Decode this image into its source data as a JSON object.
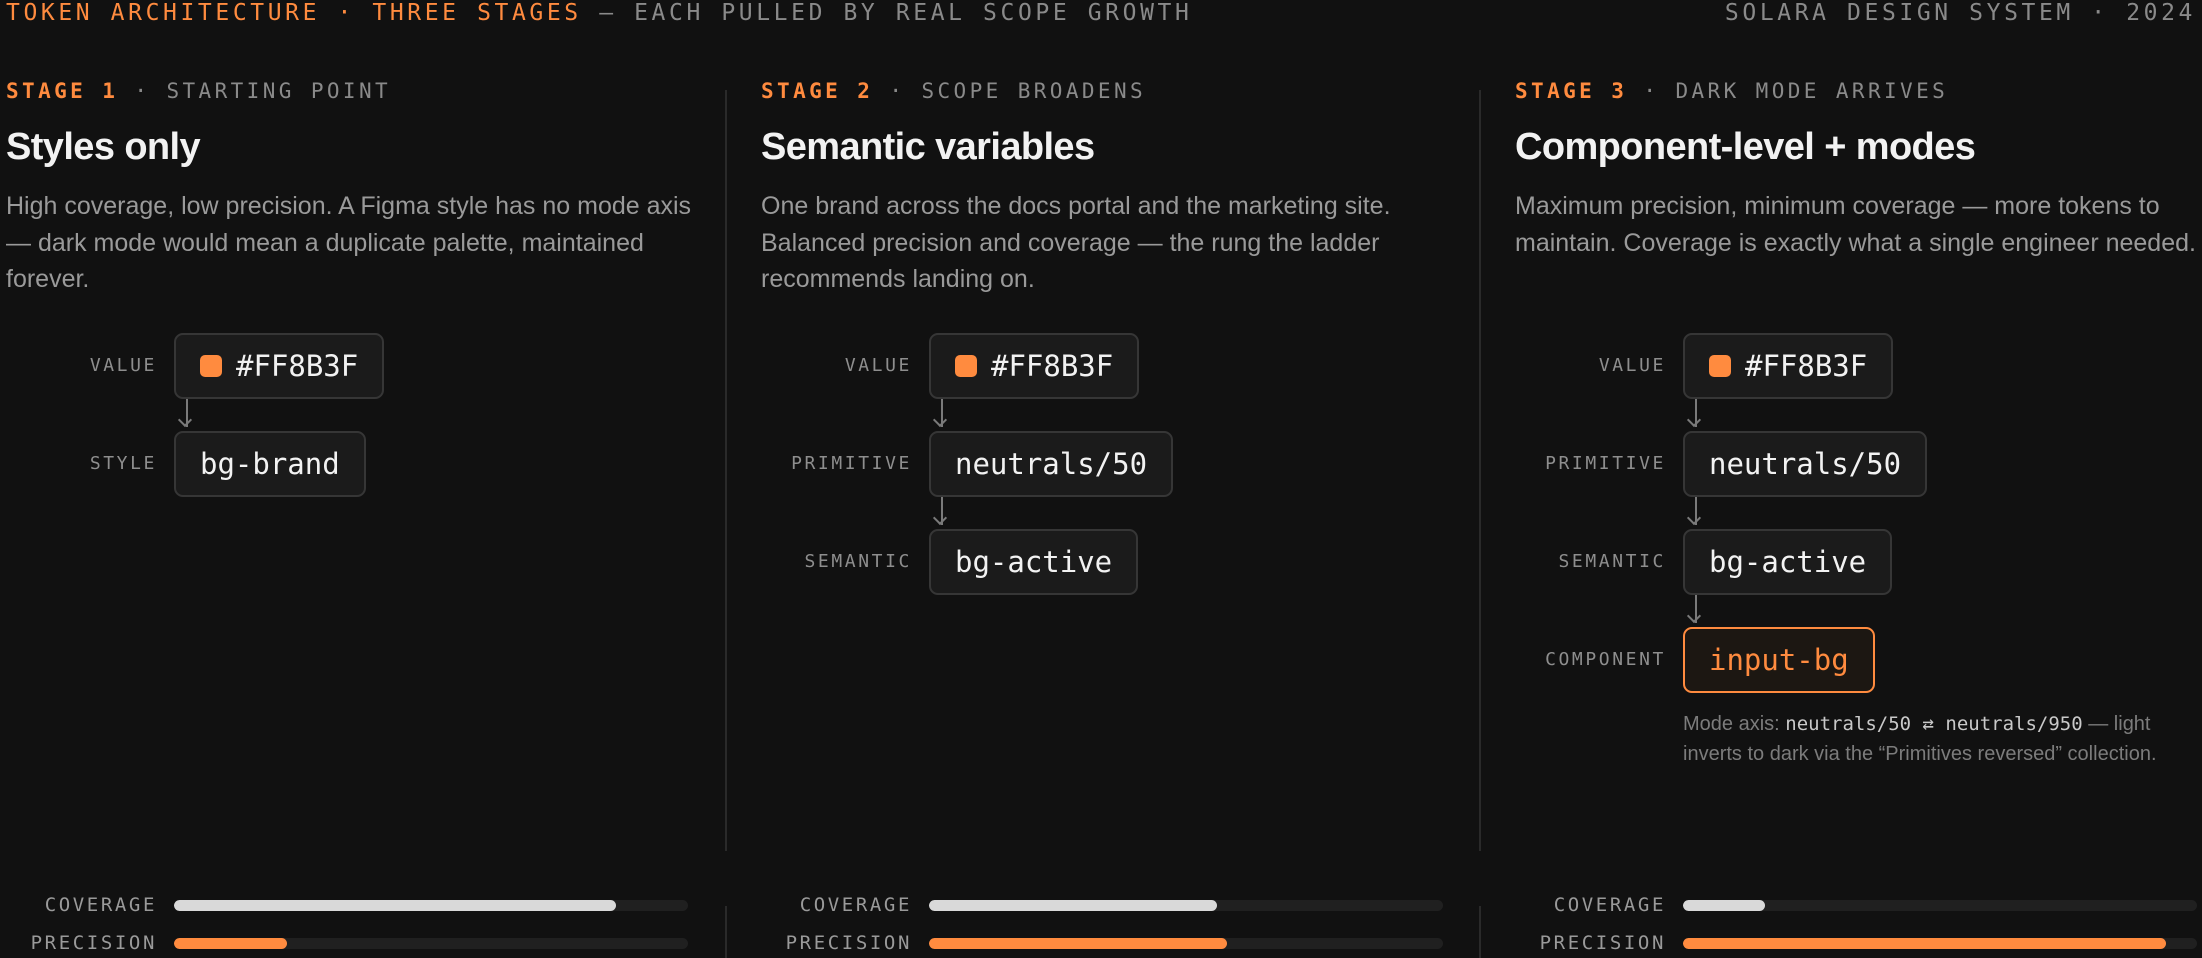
{
  "header": {
    "title_accent": "TOKEN ARCHITECTURE · THREE STAGES",
    "title_rest": " — EACH PULLED BY REAL SCOPE GROWTH",
    "meta": "SOLARA DESIGN SYSTEM · 2024"
  },
  "colors": {
    "accent": "#ff8b3f",
    "background": "#111111",
    "coverage_bar": "#d9d9d9"
  },
  "labels": {
    "value": "VALUE",
    "style": "STYLE",
    "primitive": "PRIMITIVE",
    "semantic": "SEMANTIC",
    "component": "COMPONENT",
    "coverage": "COVERAGE",
    "precision": "PRECISION"
  },
  "stages": [
    {
      "stage": "STAGE 1",
      "subtitle": " · STARTING POINT",
      "title": "Styles only",
      "description": "High coverage, low precision. A Figma style has no mode axis — dark mode would mean a duplicate palette, maintained forever.",
      "value_hex": "#FF8B3F",
      "style_token": "bg-brand",
      "coverage": 0.86,
      "precision": 0.22
    },
    {
      "stage": "STAGE 2",
      "subtitle": " · SCOPE BROADENS",
      "title": "Semantic variables",
      "description": "One brand across the docs portal and the marketing site. Balanced precision and coverage — the rung the ladder recommends landing on.",
      "value_hex": "#FF8B3F",
      "primitive_token": "neutrals/50",
      "semantic_token": "bg-active",
      "coverage": 0.56,
      "precision": 0.58
    },
    {
      "stage": "STAGE 3",
      "subtitle": " · DARK MODE ARRIVES",
      "title": "Component-level + modes",
      "description": "Maximum precision, minimum coverage — more tokens to maintain. Coverage is exactly what a single engineer needed.",
      "value_hex": "#FF8B3F",
      "primitive_token": "neutrals/50",
      "semantic_token": "bg-active",
      "component_token": "input-bg",
      "note": {
        "prefix": "Mode axis: ",
        "code": "neutrals/50 ⇄ neutrals/950",
        "suffix": " — light inverts to dark via the “Primitives reversed” collection."
      },
      "coverage": 0.16,
      "precision": 0.94
    }
  ]
}
